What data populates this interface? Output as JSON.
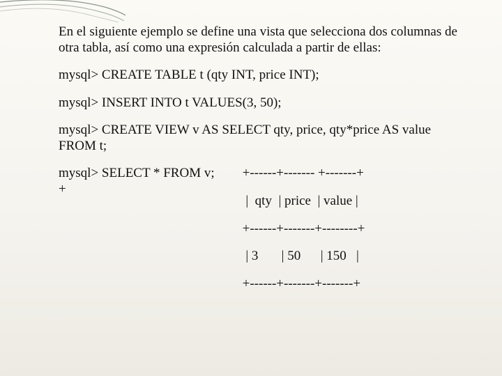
{
  "intro": "En el siguiente ejemplo se define una vista que selecciona dos columnas de otra tabla, así como una expresión calculada a partir de ellas:",
  "sql": {
    "create_table": "mysql> CREATE TABLE t (qty INT, price INT);",
    "insert": " mysql> INSERT INTO t VALUES(3, 50);",
    "create_view": "mysql> CREATE VIEW v AS SELECT qty, price, qty*price AS value FROM t;",
    "select": "mysql> SELECT * FROM v;",
    "plus": "+"
  },
  "table_output": {
    "sep_top": "+------+------- +-------+",
    "header": " |  qty  | price  | value |",
    "sep_mid": "+------+-------+--------+",
    "row": " | 3       | 50      | 150   |",
    "sep_bot": "+------+-------+-------+"
  }
}
